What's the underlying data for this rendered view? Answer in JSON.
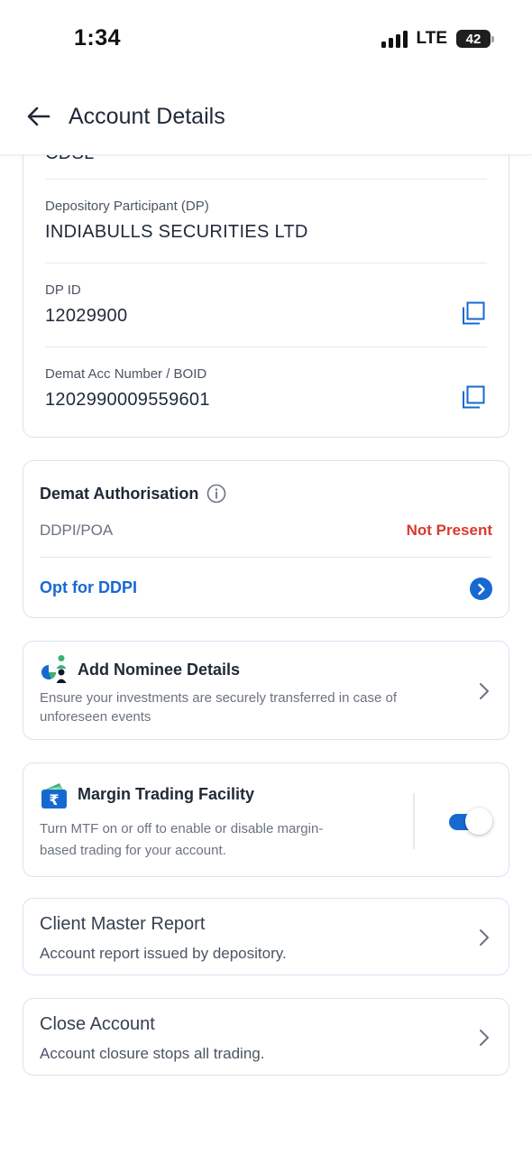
{
  "status_bar": {
    "time": "1:34",
    "network": "LTE",
    "battery": "42"
  },
  "header": {
    "title": "Account Details"
  },
  "details": {
    "clipped_value": "CDSL",
    "dp_label": "Depository Participant (DP)",
    "dp_value": "INDIABULLS SECURITIES LTD",
    "dpid_label": "DP ID",
    "dpid_value": "12029900",
    "boid_label": "Demat Acc Number / BOID",
    "boid_value": "1202990009559601"
  },
  "authorisation": {
    "title": "Demat Authorisation",
    "ddpi_label": "DDPI/POA",
    "ddpi_status": "Not Present",
    "opt_label": "Opt for DDPI"
  },
  "nominee": {
    "title": "Add Nominee Details",
    "description_line1": "Ensure your investments are securely transferred in case of",
    "description_line2": "unforeseen events"
  },
  "mtf": {
    "title": "Margin Trading Facility",
    "description_line1": "Turn MTF on or off to enable or disable margin-",
    "description_line2": "based trading for your account.",
    "enabled": true
  },
  "client_master": {
    "title": "Client Master Report",
    "description": "Account report issued by depository."
  },
  "close_account": {
    "title": "Close Account",
    "description": "Account closure stops all trading."
  },
  "colors": {
    "accent": "#1769d2",
    "danger": "#d93a2f",
    "card_border": "#d6e4f3"
  }
}
